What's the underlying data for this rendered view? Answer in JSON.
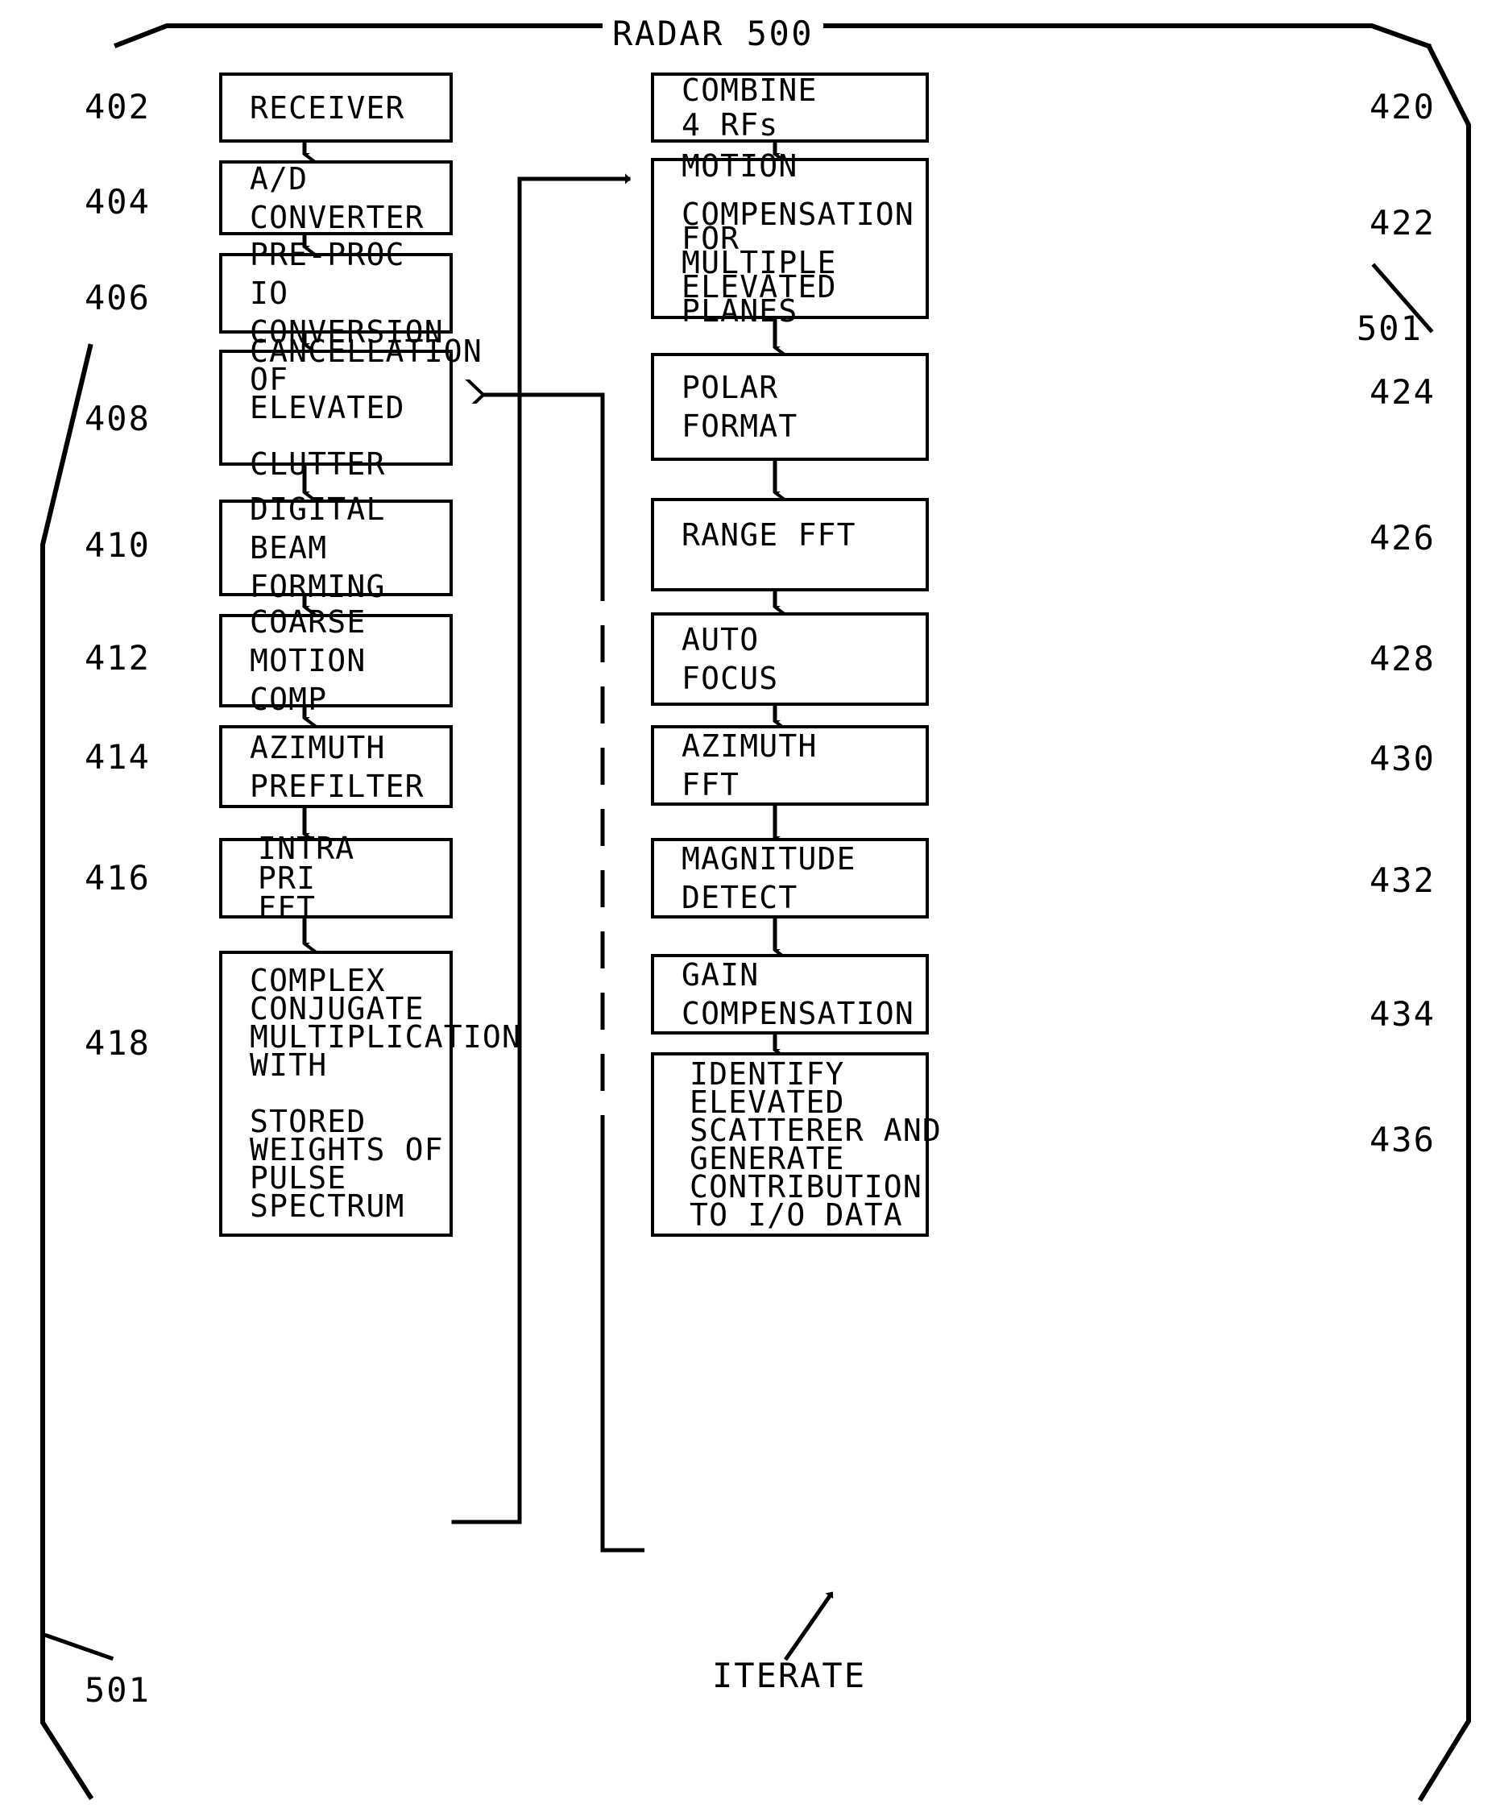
{
  "diagram": {
    "title": "RADAR 500",
    "iterate_label": "ITERATE",
    "system_ref_top_right": "501",
    "system_ref_bottom_left": "501"
  },
  "left_column": [
    {
      "ref": "402",
      "lines": "RECEIVER"
    },
    {
      "ref": "404",
      "lines": "A/D\nCONVERTER"
    },
    {
      "ref": "406",
      "lines": "PRE-PROC\nIO\nCONVERSION"
    },
    {
      "ref": "408",
      "lines": "CANCELLATION\nOF\nELEVATED\n\nCLUTTER"
    },
    {
      "ref": "410",
      "lines": "DIGITAL\nBEAM\nFORMING"
    },
    {
      "ref": "412",
      "lines": "COARSE\nMOTION\nCOMP"
    },
    {
      "ref": "414",
      "lines": "AZIMUTH\nPREFILTER"
    },
    {
      "ref": "416",
      "lines": "INTRA\nPRI\nFFT"
    },
    {
      "ref": "418",
      "lines": "COMPLEX\nCONJUGATE\nMULTIPLICATION\nWITH\n\nSTORED\nWEIGHTS OF\nPULSE\nSPECTRUM"
    }
  ],
  "right_column": [
    {
      "ref": "420",
      "lines": "COMBINE\n4 RFs"
    },
    {
      "ref": "422",
      "lines": "MOTION\n\nCOMPENSATION\nFOR\nMULTIPLE\nELEVATED\nPLANES"
    },
    {
      "ref": "424",
      "lines": "POLAR\nFORMAT"
    },
    {
      "ref": "426",
      "lines": "RANGE FFT"
    },
    {
      "ref": "428",
      "lines": "AUTO\nFOCUS"
    },
    {
      "ref": "430",
      "lines": "AZIMUTH\nFFT"
    },
    {
      "ref": "432",
      "lines": "MAGNITUDE\nDETECT"
    },
    {
      "ref": "434",
      "lines": "GAIN\nCOMPENSATION"
    },
    {
      "ref": "436",
      "lines": "IDENTIFY\nELEVATED\nSCATTERER AND\nGENERATE\nCONTRIBUTION\nTO I/O DATA"
    }
  ],
  "colors": {
    "ink": "#000000",
    "paper": "#ffffff"
  }
}
